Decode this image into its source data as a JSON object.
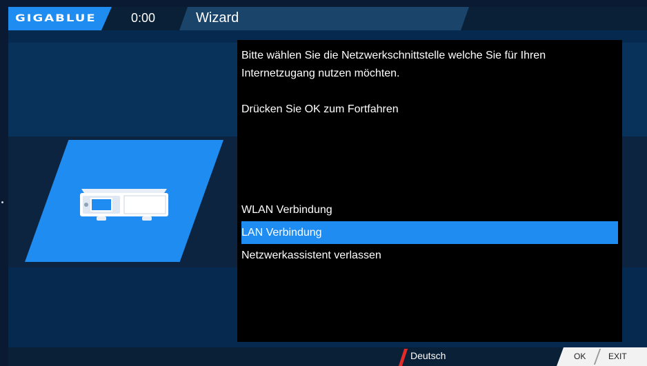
{
  "header": {
    "logo": "GIGABLUE",
    "time": "0:00",
    "title": "Wizard"
  },
  "dialog": {
    "message_line1": "Bitte wählen Sie die Netzwerkschnittstelle welche Sie für Ihren",
    "message_line2": "Internetzugang nutzen möchten.",
    "message_line3": "Drücken Sie OK zum Fortfahren",
    "options": [
      {
        "label": "WLAN Verbindung",
        "selected": false
      },
      {
        "label": "LAN Verbindung",
        "selected": true
      },
      {
        "label": "Netzwerkassistent verlassen",
        "selected": false
      }
    ]
  },
  "footer": {
    "language": "Deutsch",
    "key_ok": "OK",
    "key_exit": "EXIT"
  },
  "colors": {
    "accent": "#1e8cf0",
    "background": "#062a4f",
    "dialog": "#000000",
    "language_marker": "#e62a2a"
  },
  "icons": {
    "device": "receiver-device-icon"
  }
}
